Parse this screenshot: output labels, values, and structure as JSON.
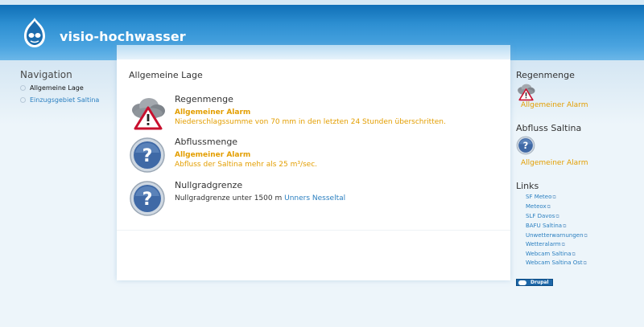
{
  "site": {
    "name": "visio-hochwasser"
  },
  "nav": {
    "title": "Navigation",
    "items": [
      {
        "label": "Allgemeine Lage",
        "active": true
      },
      {
        "label": "Einzugsgebiet Saltina",
        "active": false
      }
    ]
  },
  "main": {
    "title": "Allgemeine Lage",
    "entries": [
      {
        "title": "Regenmenge",
        "icon": "rain-warning-icon",
        "alarm": "Allgemeiner Alarm",
        "desc": "Niederschlagssumme von 70 mm in den letzten 24 Stunden überschritten."
      },
      {
        "title": "Abflussmenge",
        "icon": "question-icon",
        "alarm": "Allgemeiner Alarm",
        "desc": "Abfluss der Saltina mehr als 25 m³/sec."
      },
      {
        "title": "Nullgradgrenze",
        "icon": "question-icon",
        "text": "Nullgradgrenze unter 1500 m",
        "link": "Unners Nesseltal"
      }
    ]
  },
  "right": {
    "rain": {
      "title": "Regenmenge",
      "alarm": "Allgemeiner Alarm",
      "icon": "rain-warning-icon"
    },
    "flow": {
      "title": "Abfluss Saltina",
      "alarm": "Allgemeiner Alarm",
      "icon": "question-icon"
    },
    "links": {
      "title": "Links",
      "items": [
        "SF Meteo",
        "Meteox",
        "SLF Davos",
        "BAFU Saltina",
        "Unwetterwarnungen",
        "Wetteralarm",
        "Webcam Saltina",
        "Webcam Saltina Ost"
      ]
    }
  },
  "footer": {
    "badge": "Drupal"
  },
  "colors": {
    "accent": "#e39e00",
    "link": "#2a7fc0",
    "header": "#2d8fd2"
  }
}
